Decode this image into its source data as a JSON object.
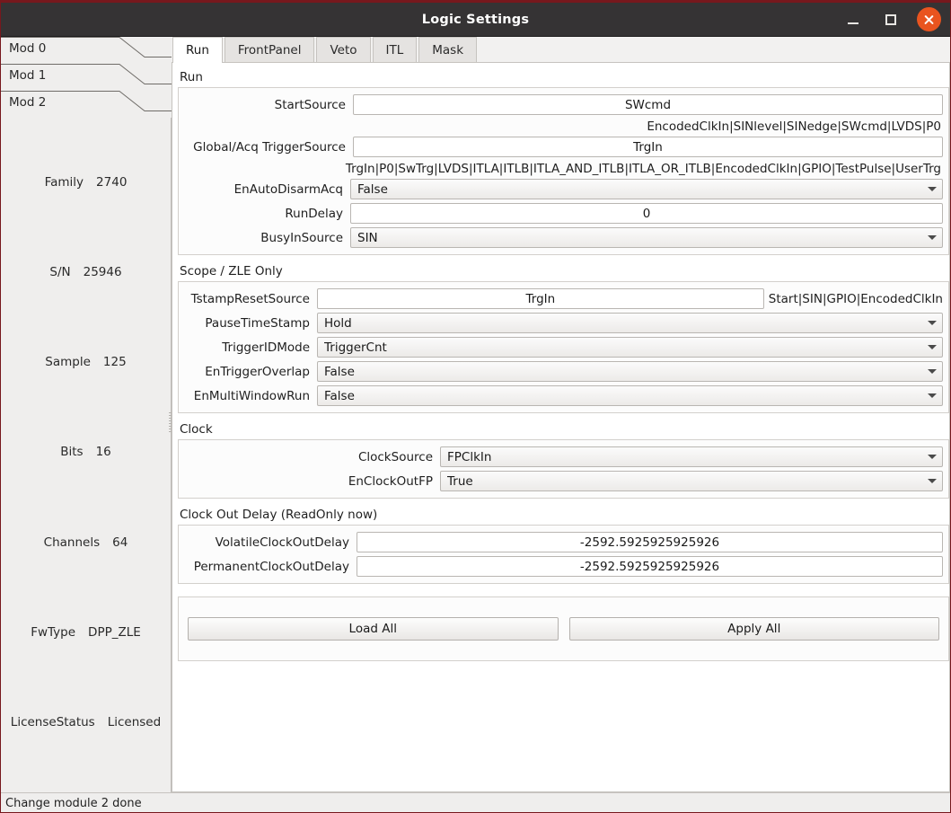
{
  "window": {
    "title": "Logic Settings",
    "minimize_label": "Minimize",
    "maximize_label": "Maximize",
    "close_label": "Close",
    "accent_border": "#77181d",
    "titlebar_bg": "#353334",
    "close_bg": "#e9541f"
  },
  "sidebar": {
    "module_tabs": [
      {
        "label": "Mod 0",
        "selected": false
      },
      {
        "label": "Mod 1",
        "selected": false
      },
      {
        "label": "Mod 2",
        "selected": true
      }
    ],
    "info": [
      {
        "key": "Family",
        "value": "2740"
      },
      {
        "key": "S/N",
        "value": "25946"
      },
      {
        "key": "Sample",
        "value": "125"
      },
      {
        "key": "Bits",
        "value": "16"
      },
      {
        "key": "Channels",
        "value": "64"
      },
      {
        "key": "FwType",
        "value": "DPP_ZLE"
      },
      {
        "key": "LicenseStatus",
        "value": "Licensed"
      }
    ]
  },
  "tabs": [
    {
      "label": "Run",
      "active": true
    },
    {
      "label": "FrontPanel",
      "active": false
    },
    {
      "label": "Veto",
      "active": false
    },
    {
      "label": "ITL",
      "active": false
    },
    {
      "label": "Mask",
      "active": false
    }
  ],
  "sections": {
    "run": {
      "title": "Run",
      "fields": {
        "start_source": {
          "label": "StartSource",
          "value": "SWcmd",
          "hint": "EncodedClkIn|SINlevel|SINedge|SWcmd|LVDS|P0"
        },
        "trigger_source": {
          "label": "Global/Acq TriggerSource",
          "value": "TrgIn",
          "hint": "TrgIn|P0|SwTrg|LVDS|ITLA|ITLB|ITLA_AND_ITLB|ITLA_OR_ITLB|EncodedClkIn|GPIO|TestPulse|UserTrg"
        },
        "en_auto_disarm_acq": {
          "label": "EnAutoDisarmAcq",
          "value": "False"
        },
        "run_delay": {
          "label": "RunDelay",
          "value": "0"
        },
        "busy_in_source": {
          "label": "BusyInSource",
          "value": "SIN"
        }
      }
    },
    "scope_zle": {
      "title": "Scope / ZLE Only",
      "fields": {
        "tstamp_reset_source": {
          "label": "TstampResetSource",
          "value": "TrgIn",
          "hint": "Start|SIN|GPIO|EncodedClkIn"
        },
        "pause_timestamp": {
          "label": "PauseTimeStamp",
          "value": "Hold"
        },
        "trigger_id_mode": {
          "label": "TriggerIDMode",
          "value": "TriggerCnt"
        },
        "en_trigger_overlap": {
          "label": "EnTriggerOverlap",
          "value": "False"
        },
        "en_multi_window_run": {
          "label": "EnMultiWindowRun",
          "value": "False"
        }
      }
    },
    "clock": {
      "title": "Clock",
      "fields": {
        "clock_source": {
          "label": "ClockSource",
          "value": "FPClkIn"
        },
        "en_clock_out_fp": {
          "label": "EnClockOutFP",
          "value": "True"
        }
      }
    },
    "clock_out_delay": {
      "title": "Clock Out Delay (ReadOnly now)",
      "fields": {
        "volatile": {
          "label": "VolatileClockOutDelay",
          "value": "-2592.5925925925926"
        },
        "permanent": {
          "label": "PermanentClockOutDelay",
          "value": "-2592.5925925925926"
        }
      }
    }
  },
  "actions": {
    "load_all": "Load All",
    "apply_all": "Apply All"
  },
  "statusbar": {
    "message": "Change module 2 done"
  }
}
